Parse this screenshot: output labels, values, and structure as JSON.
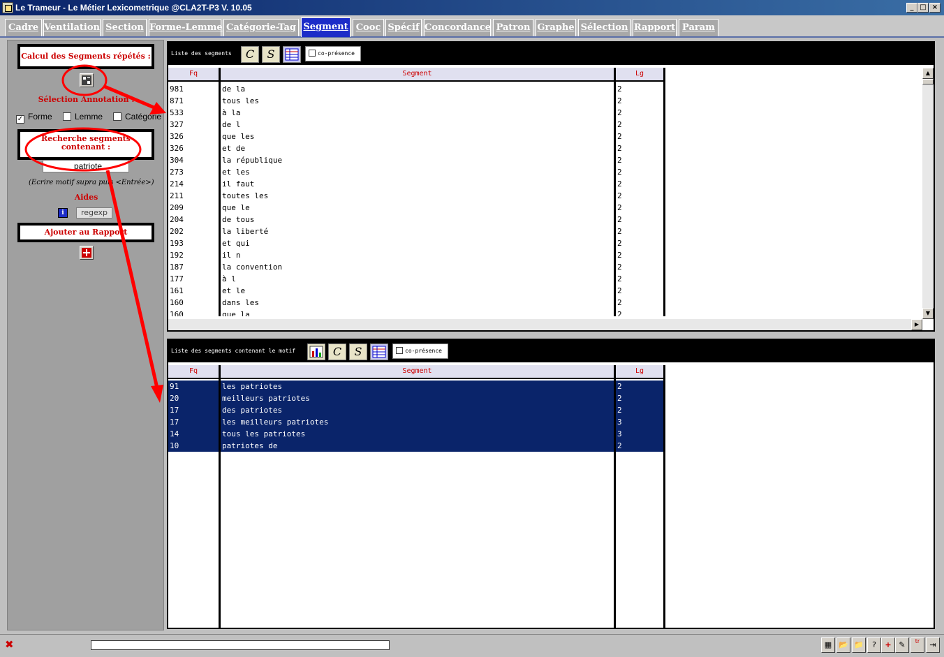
{
  "window": {
    "title": "Le Trameur - Le Métier Lexicometrique @CLA2T-P3 V. 10.05",
    "minimize": "_",
    "maximize": "□",
    "close": "×"
  },
  "tabs": [
    {
      "label": "Cadre",
      "active": false
    },
    {
      "label": "Ventilation",
      "active": false
    },
    {
      "label": "Section",
      "active": false
    },
    {
      "label": "Forme-Lemme",
      "active": false
    },
    {
      "label": "Catégorie-Tag",
      "active": false
    },
    {
      "label": "Segment",
      "active": true
    },
    {
      "label": "Cooc",
      "active": false
    },
    {
      "label": "Spécif",
      "active": false
    },
    {
      "label": "Concordance",
      "active": false
    },
    {
      "label": "Patron",
      "active": false
    },
    {
      "label": "Graphe",
      "active": false
    },
    {
      "label": "Sélection",
      "active": false
    },
    {
      "label": "Rapport",
      "active": false
    },
    {
      "label": "Param",
      "active": false
    }
  ],
  "left": {
    "calc_label": "Calcul des Segments répétés :",
    "annotation_label": "Sélection Annotation :",
    "checkboxes": [
      {
        "label": "Forme",
        "checked": true
      },
      {
        "label": "Lemme",
        "checked": false
      },
      {
        "label": "Catégorie",
        "checked": false
      }
    ],
    "search_label_1": "Recherche segments",
    "search_label_2": "contenant :",
    "search_value": "patriote",
    "hint": "(Ecrire motif supra puis <Entrée>)",
    "aides_label": "Aides",
    "regexp_label": "regexp",
    "add_report_label": "Ajouter au Rapport"
  },
  "top_panel": {
    "label": "Liste des segments",
    "copresence_label": "co-présence",
    "headers": {
      "fq": "Fq",
      "segment": "Segment",
      "lg": "Lg"
    },
    "rows": [
      {
        "fq": "981",
        "segment": "de la",
        "lg": "2"
      },
      {
        "fq": "871",
        "segment": "tous les",
        "lg": "2"
      },
      {
        "fq": "533",
        "segment": "à la",
        "lg": "2"
      },
      {
        "fq": "327",
        "segment": "de l",
        "lg": "2"
      },
      {
        "fq": "326",
        "segment": "que les",
        "lg": "2"
      },
      {
        "fq": "326",
        "segment": "et de",
        "lg": "2"
      },
      {
        "fq": "304",
        "segment": "la république",
        "lg": "2"
      },
      {
        "fq": "273",
        "segment": "et les",
        "lg": "2"
      },
      {
        "fq": "214",
        "segment": "il faut",
        "lg": "2"
      },
      {
        "fq": "211",
        "segment": "toutes les",
        "lg": "2"
      },
      {
        "fq": "209",
        "segment": "que le",
        "lg": "2"
      },
      {
        "fq": "204",
        "segment": "de tous",
        "lg": "2"
      },
      {
        "fq": "202",
        "segment": "la liberté",
        "lg": "2"
      },
      {
        "fq": "193",
        "segment": "et qui",
        "lg": "2"
      },
      {
        "fq": "192",
        "segment": "il n",
        "lg": "2"
      },
      {
        "fq": "187",
        "segment": "la convention",
        "lg": "2"
      },
      {
        "fq": "177",
        "segment": "à l",
        "lg": "2"
      },
      {
        "fq": "161",
        "segment": "et le",
        "lg": "2"
      },
      {
        "fq": "160",
        "segment": "dans les",
        "lg": "2"
      },
      {
        "fq": "160",
        "segment": "que la",
        "lg": "2"
      }
    ]
  },
  "bottom_panel": {
    "label": "Liste des segments contenant le motif",
    "copresence_label": "co-présence",
    "headers": {
      "fq": "Fq",
      "segment": "Segment",
      "lg": "Lg"
    },
    "rows": [
      {
        "fq": "91",
        "segment": "les patriotes",
        "lg": "2"
      },
      {
        "fq": "20",
        "segment": "meilleurs patriotes",
        "lg": "2"
      },
      {
        "fq": "17",
        "segment": "des patriotes",
        "lg": "2"
      },
      {
        "fq": "17",
        "segment": "les meilleurs patriotes",
        "lg": "3"
      },
      {
        "fq": "14",
        "segment": "tous les patriotes",
        "lg": "3"
      },
      {
        "fq": "10",
        "segment": "patriotes de",
        "lg": "2"
      }
    ]
  },
  "status": {
    "close_symbol": "✖",
    "progress": 0
  },
  "colors": {
    "accent": "#1c2cc8",
    "selection": "#0a246a",
    "annotation": "#ff0000",
    "label_red": "#cc0000"
  }
}
